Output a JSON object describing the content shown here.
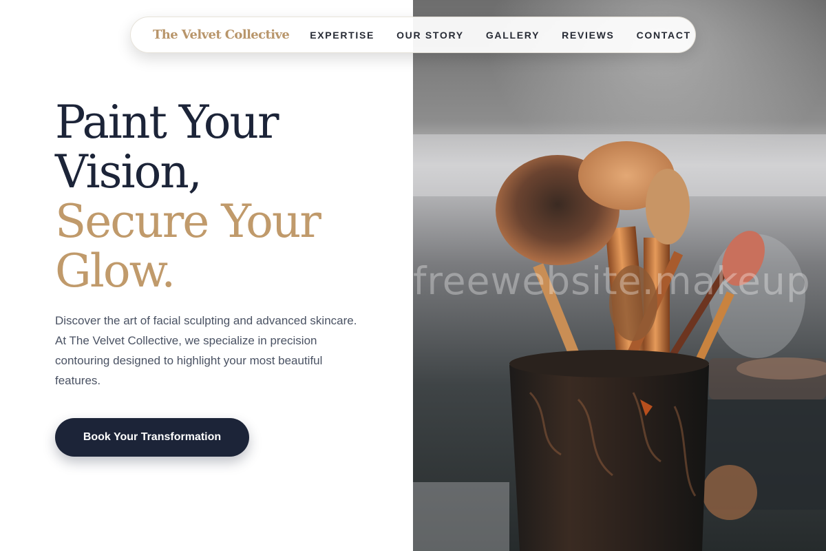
{
  "nav": {
    "brand": "The Velvet Collective",
    "links": [
      {
        "label": "EXPERTISE"
      },
      {
        "label": "OUR STORY"
      },
      {
        "label": "GALLERY"
      },
      {
        "label": "REVIEWS"
      },
      {
        "label": "CONTACT"
      }
    ]
  },
  "hero": {
    "title_lines": [
      "Paint Your",
      "Vision,",
      "Secure Your",
      "Glow."
    ],
    "description": "Discover the art of facial sculpting and advanced skincare. At The Velvet Collective, we specialize in precision contouring designed to highlight your most beautiful features.",
    "cta_label": "Book Your Transformation"
  },
  "image": {
    "subject": "makeup brushes in a dark ornate cup",
    "watermark": "freewebsite.makeup"
  },
  "colors": {
    "navy": "#1c2438",
    "gold": "#c09a6b",
    "brand_gold": "#b8956a",
    "body_text": "#4a5263",
    "background": "#ffffff"
  }
}
